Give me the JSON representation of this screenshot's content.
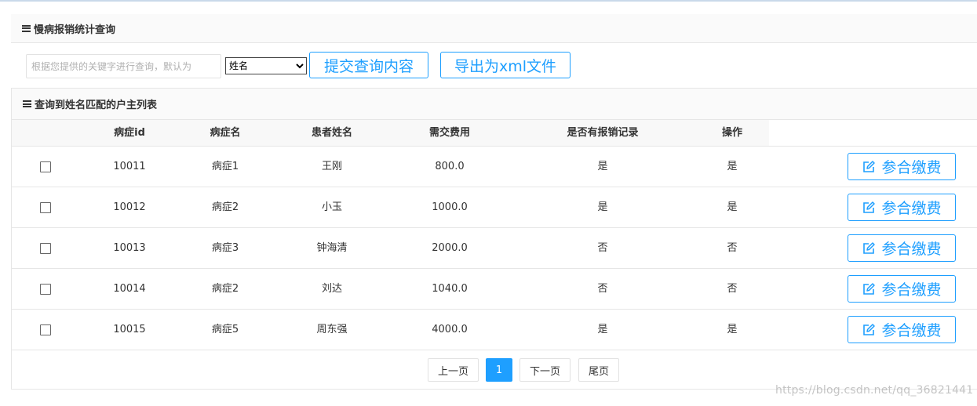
{
  "panel": {
    "title": "慢病报销统计查询"
  },
  "search": {
    "placeholder": "根据您提供的关键字进行查询，默认为",
    "field_selected": "姓名",
    "submit_label": "提交查询内容",
    "export_label": "导出为xml文件"
  },
  "list": {
    "title": "查询到姓名匹配的户主列表",
    "columns": [
      "病症id",
      "病症名",
      "患者姓名",
      "需交费用",
      "是否有报销记录",
      "操作"
    ],
    "action_label": "参合缴费",
    "rows": [
      {
        "id": "10011",
        "disease": "病症1",
        "patient": "王刚",
        "fee": "800.0",
        "has_record": "是",
        "op": "是"
      },
      {
        "id": "10012",
        "disease": "病症2",
        "patient": "小玉",
        "fee": "1000.0",
        "has_record": "是",
        "op": "是"
      },
      {
        "id": "10013",
        "disease": "病症3",
        "patient": "钟海清",
        "fee": "2000.0",
        "has_record": "否",
        "op": "否"
      },
      {
        "id": "10014",
        "disease": "病症2",
        "patient": "刘达",
        "fee": "1040.0",
        "has_record": "否",
        "op": "否"
      },
      {
        "id": "10015",
        "disease": "病症5",
        "patient": "周东强",
        "fee": "4000.0",
        "has_record": "是",
        "op": "是"
      }
    ]
  },
  "pagination": {
    "prev": "上一页",
    "current": "1",
    "next": "下一页",
    "last": "尾页"
  },
  "watermark": "https://blog.csdn.net/qq_36821441",
  "colors": {
    "accent": "#1E9FFF",
    "border": "#e6e6e6",
    "header_bg": "#fafafa"
  }
}
